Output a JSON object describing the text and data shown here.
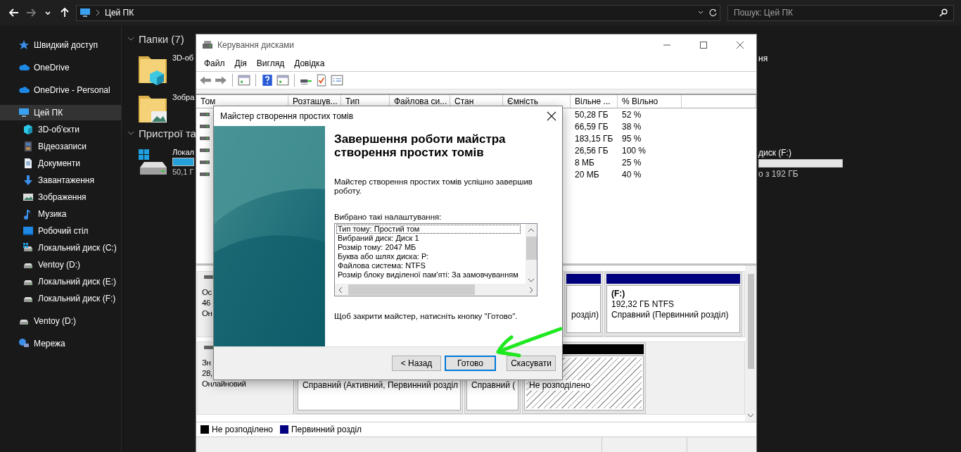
{
  "explorer": {
    "nav": [
      {
        "kind": "back",
        "disabled": false
      },
      {
        "kind": "forward",
        "disabled": true
      },
      {
        "kind": "recent",
        "disabled": false
      },
      {
        "kind": "up",
        "disabled": false
      }
    ],
    "address": {
      "path": "Цей ПК"
    },
    "search": {
      "placeholder": "Пошук: Цей ПК"
    },
    "sidebar": {
      "items": [
        {
          "kind": "star",
          "label": "Швидкий доступ",
          "selected": false
        },
        {
          "kind": "cloud",
          "label": "OneDrive",
          "selected": false
        },
        {
          "kind": "cloud",
          "label": "OneDrive - Personal",
          "selected": false
        },
        {
          "kind": "pc",
          "label": "Цей ПК",
          "selected": true,
          "children": [
            {
              "kind": "cube",
              "label": "3D-об'єкти",
              "selected": false
            },
            {
              "kind": "film",
              "label": "Відеозаписи",
              "selected": false
            },
            {
              "kind": "doc",
              "label": "Документи",
              "selected": false
            },
            {
              "kind": "download",
              "label": "Завантаження",
              "selected": false
            },
            {
              "kind": "image",
              "label": "Зображення",
              "selected": false
            },
            {
              "kind": "music",
              "label": "Музика",
              "selected": false
            },
            {
              "kind": "desktop",
              "label": "Робочий стіл",
              "selected": false
            },
            {
              "kind": "drive-win",
              "label": "Локальний диск (C:)",
              "selected": false
            },
            {
              "kind": "drive",
              "label": "Ventoy (D:)",
              "selected": false
            },
            {
              "kind": "drive",
              "label": "Локальний диск (E:)",
              "selected": false
            },
            {
              "kind": "drive",
              "label": "Локальний диск (F:)",
              "selected": false
            }
          ]
        },
        {
          "kind": "drive",
          "label": "Ventoy (D:)",
          "selected": false
        },
        {
          "kind": "network",
          "label": "Мережа",
          "selected": false
        }
      ]
    },
    "sections": [
      {
        "title": "Папки (7)",
        "expanded": true,
        "rows": [
          {
            "left": {
              "kind": "cube-folder",
              "label": "3D-об"
            },
            "right": {
              "label": "ня"
            }
          },
          {
            "left": {
              "kind": "image-folder",
              "label": "Зобра"
            }
          }
        ]
      },
      {
        "title": "Пристрої та",
        "expanded": true,
        "rows": [
          {
            "left": {
              "kind": "drive-win",
              "label": "Локал",
              "level": 1,
              "detail": "50,1 Г"
            },
            "right": {
              "label": "диск (F:)",
              "level": 0,
              "detail": "о з 192 ГБ"
            }
          }
        ]
      }
    ]
  },
  "disk_management": {
    "title": "Керування дисками",
    "menu": [
      "Файл",
      "Дія",
      "Вигляд",
      "Довідка"
    ],
    "toolbar": [
      {
        "kind": "back"
      },
      {
        "kind": "forward"
      },
      {
        "kind": "separator"
      },
      {
        "kind": "console-tree"
      },
      {
        "kind": "separator"
      },
      {
        "kind": "help"
      },
      {
        "kind": "action-pane"
      },
      {
        "kind": "separator"
      },
      {
        "kind": "connect"
      },
      {
        "kind": "check"
      },
      {
        "kind": "properties"
      }
    ],
    "columns": [
      "Том",
      "Розташув...",
      "Тип",
      "Файлова си...",
      "Стан",
      "Ємність",
      "Вільне ...",
      "% Вільно"
    ],
    "rows": [
      {
        "free": "50,28 ГБ",
        "percent": "52 %"
      },
      {
        "free": "66,59 ГБ",
        "percent": "38 %"
      },
      {
        "free": "183,15 ГБ",
        "percent": "95 %"
      },
      {
        "free": "26,56 ГБ",
        "percent": "100 %"
      },
      {
        "free": "8 МБ",
        "percent": "25 %"
      },
      {
        "free": "20 МБ",
        "percent": "40 %"
      }
    ],
    "disks": [
      {
        "label_lines": [
          "Ос",
          "46",
          "Он"
        ],
        "partitions": [
          {
            "kind": "primary",
            "status": "розділ)"
          },
          {
            "kind": "primary",
            "name": "(F:)",
            "size": "192,32 ГБ NTFS",
            "status": "Справний (Первинний розділ)"
          }
        ]
      },
      {
        "label_lines": [
          "Зн",
          "28,",
          "Онлайновий"
        ],
        "partitions": [
          {
            "kind": "primary",
            "status": "Справний (Активний, Первинний розділ"
          },
          {
            "kind": "primary",
            "status": "Справний ("
          },
          {
            "kind": "unallocated",
            "status": "Не розподілено"
          }
        ]
      }
    ],
    "legend": [
      {
        "kind": "unallocated",
        "label": "Не розподілено"
      },
      {
        "kind": "primary",
        "label": "Первинний розділ"
      }
    ]
  },
  "wizard": {
    "title": "Майстер створення простих томів",
    "heading": "Завершення роботи майстра створення простих томів",
    "intro": "Майстер створення простих томів успішно завершив роботу.",
    "settings_label": "Вибрано такі налаштування:",
    "settings": [
      {
        "text": "Тип тому: Простий том",
        "focused": true
      },
      {
        "text": "Вибраний диск: Диск 1",
        "focused": false
      },
      {
        "text": "Розмір тому: 2047 МБ",
        "focused": false
      },
      {
        "text": "Буква або шлях диска: P:",
        "focused": false
      },
      {
        "text": "Файлова система: NTFS",
        "focused": false
      },
      {
        "text": "Розмір блоку виділеної пам'яті: За замовчуванням",
        "focused": false
      }
    ],
    "closing_note": "Щоб закрити майстер, натисніть кнопку \"Готово\".",
    "buttons": [
      {
        "label": "< Назад",
        "default": false
      },
      {
        "label": "Готово",
        "default": true
      },
      {
        "label": "Скасувати",
        "default": false
      }
    ]
  }
}
